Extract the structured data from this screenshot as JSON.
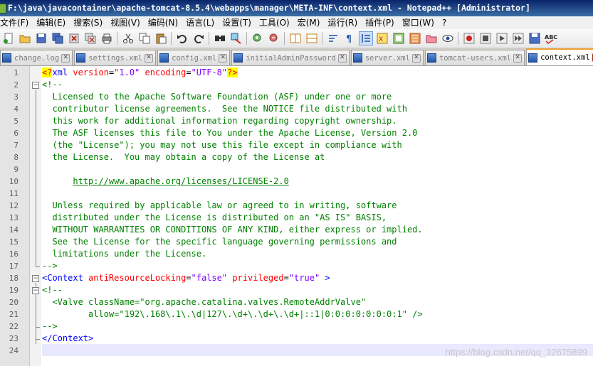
{
  "window": {
    "title": "F:\\java\\javacontainer\\apache-tomcat-8.5.4\\webapps\\manager\\META-INF\\context.xml - Notepad++ [Administrator]"
  },
  "menu": [
    {
      "label": "文件(F)"
    },
    {
      "label": "编辑(E)"
    },
    {
      "label": "搜索(S)"
    },
    {
      "label": "视图(V)"
    },
    {
      "label": "编码(N)"
    },
    {
      "label": "语言(L)"
    },
    {
      "label": "设置(T)"
    },
    {
      "label": "工具(O)"
    },
    {
      "label": "宏(M)"
    },
    {
      "label": "运行(R)"
    },
    {
      "label": "插件(P)"
    },
    {
      "label": "窗口(W)"
    },
    {
      "label": "?"
    }
  ],
  "tabs": [
    {
      "label": "change.log",
      "active": false
    },
    {
      "label": "settings.xml",
      "active": false
    },
    {
      "label": "config.xml",
      "active": false
    },
    {
      "label": "initialAdminPassword",
      "active": false
    },
    {
      "label": "server.xml",
      "active": false
    },
    {
      "label": "tomcat-users.xml",
      "active": false
    },
    {
      "label": "context.xml",
      "active": true
    }
  ],
  "toolbar_abc": "ABC",
  "colors": {
    "comment": "#008000",
    "tag": "#0000ff",
    "attribute": "#ff0000",
    "value": "#8000ff",
    "current_line": "#e8e8ff"
  },
  "editor": {
    "lines": [
      {
        "n": "1"
      },
      {
        "n": "2"
      },
      {
        "n": "3"
      },
      {
        "n": "4"
      },
      {
        "n": "5"
      },
      {
        "n": "6"
      },
      {
        "n": "7"
      },
      {
        "n": "8"
      },
      {
        "n": "9"
      },
      {
        "n": "10"
      },
      {
        "n": "11"
      },
      {
        "n": "12"
      },
      {
        "n": "13"
      },
      {
        "n": "14"
      },
      {
        "n": "15"
      },
      {
        "n": "16"
      },
      {
        "n": "17"
      },
      {
        "n": "18"
      },
      {
        "n": "19"
      },
      {
        "n": "20"
      },
      {
        "n": "21"
      },
      {
        "n": "22"
      },
      {
        "n": "23"
      },
      {
        "n": "24"
      }
    ],
    "code": {
      "l1_pi_open": "<?",
      "l1_xml": "xml ",
      "l1_attr1": "version",
      "l1_eq1": "=",
      "l1_val1": "\"1.0\"",
      "l1_attr2": " encoding",
      "l1_eq2": "=",
      "l1_val2": "\"UTF-8\"",
      "l1_pi_close": "?>",
      "l2": "<!--",
      "l3": "  Licensed to the Apache Software Foundation (ASF) under one or more",
      "l4": "  contributor license agreements.  See the NOTICE file distributed with",
      "l5": "  this work for additional information regarding copyright ownership.",
      "l6": "  The ASF licenses this file to You under the Apache License, Version 2.0",
      "l7": "  (the \"License\"); you may not use this file except in compliance with",
      "l8": "  the License.  You may obtain a copy of the License at",
      "l9": "",
      "l10_indent": "      ",
      "l10_link": "http://www.apache.org/licenses/LICENSE-2.0",
      "l11": "",
      "l12": "  Unless required by applicable law or agreed to in writing, software",
      "l13": "  distributed under the License is distributed on an \"AS IS\" BASIS,",
      "l14": "  WITHOUT WARRANTIES OR CONDITIONS OF ANY KIND, either express or implied.",
      "l15": "  See the License for the specific language governing permissions and",
      "l16": "  limitations under the License.",
      "l17": "-->",
      "l18_tag": "<Context",
      "l18_attr1": " antiResourceLocking",
      "l18_eq1": "=",
      "l18_val1": "\"false\"",
      "l18_attr2": " privileged",
      "l18_eq2": "=",
      "l18_val2": "\"true\"",
      "l18_close": " >",
      "l19": "<!--",
      "l20": "  <Valve className=\"org.apache.catalina.valves.RemoteAddrValve\"",
      "l21": "         allow=\"192\\.168\\.1\\.\\d|127\\.\\d+\\.\\d+\\.\\d+|::1|0:0:0:0:0:0:0:1\" />",
      "l22": "-->",
      "l23": "</Context>",
      "l24": ""
    }
  },
  "watermark": "https://blog.csdn.net/qq_32675899"
}
